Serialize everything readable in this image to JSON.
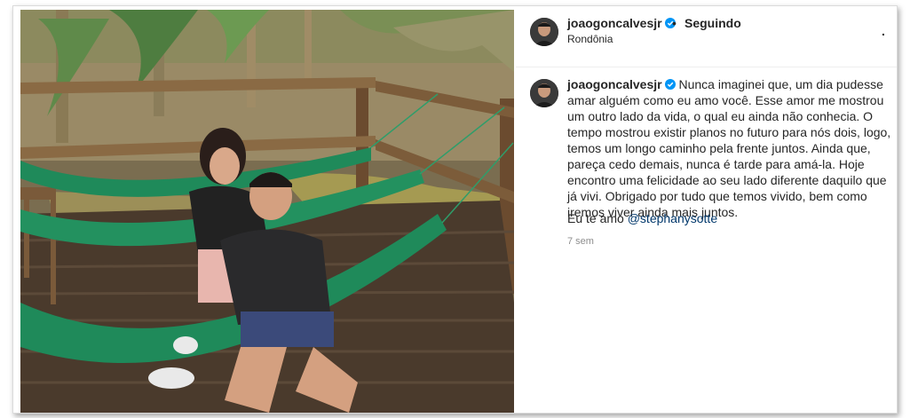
{
  "post": {
    "username": "joaogoncalvesjr",
    "follow_label": "Seguindo",
    "separator": "•",
    "location": "Rondônia",
    "more_label": ".",
    "caption": "Nunca imaginei que, um dia pudesse amar alguém como eu amo você. Esse amor me mostrou um outro lado da vida, o qual eu ainda não conhecia. O tempo mostrou existir planos no futuro para nós dois, logo, temos um longo caminho pela frente juntos. Ainda que, pareça cedo demais, nunca é tarde para amá-la. Hoje encontro uma felicidade ao seu lado diferente daquilo que já vivi. Obrigado por tudo que temos vivido, bem como iremos viver ainda mais juntos.",
    "love_text": "Eu te amo",
    "mention": "@stephanysotte",
    "time": "7 sem"
  },
  "colors": {
    "verified": "#0095f6",
    "mention": "#00376b",
    "hammock": "#1f8a5a",
    "deck": "#4a3a2c"
  },
  "icons": {
    "verified": "verified-badge-icon",
    "more": "more-options-icon"
  }
}
